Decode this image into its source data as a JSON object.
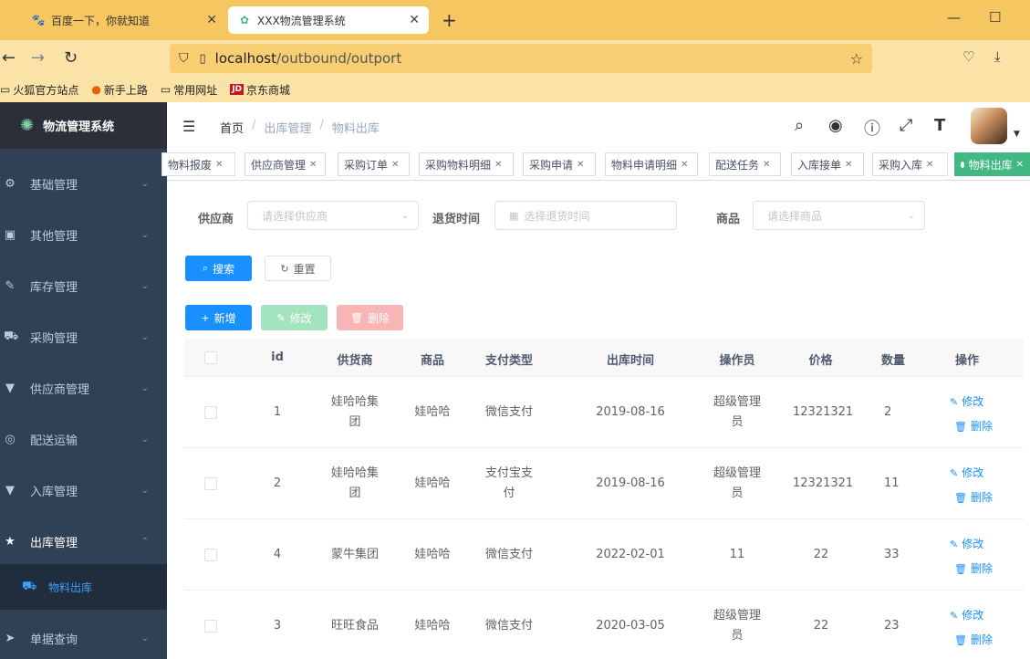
{
  "browser": {
    "tabs": [
      {
        "title": "百度一下，你就知道",
        "icon": "baidu-paw-icon"
      },
      {
        "title": "XXX物流管理系统",
        "icon": "app-leaf-icon"
      }
    ],
    "url_host": "localhost",
    "url_path": "/outbound/outport",
    "bookmarks": [
      "火狐官方站点",
      "新手上路",
      "常用网址",
      "京东商城"
    ],
    "bookmark_jd_badge": "JD"
  },
  "sidebar": {
    "app_name": "物流管理系统",
    "items": [
      {
        "label": "基础管理",
        "icon": "gear-icon"
      },
      {
        "label": "其他管理",
        "icon": "briefcase-icon"
      },
      {
        "label": "库存管理",
        "icon": "edit-icon"
      },
      {
        "label": "采购管理",
        "icon": "cart-icon"
      },
      {
        "label": "供应商管理",
        "icon": "shirt-icon"
      },
      {
        "label": "配送运输",
        "icon": "lifebuoy-icon"
      },
      {
        "label": "入库管理",
        "icon": "shirt-icon"
      },
      {
        "label": "出库管理",
        "icon": "star-icon"
      },
      {
        "label": "单据查询",
        "icon": "send-icon"
      }
    ],
    "sub_active": "物料出库"
  },
  "header": {
    "breadcrumb": [
      "首页",
      "出库管理",
      "物料出库"
    ]
  },
  "tags": [
    "物料报废",
    "供应商管理",
    "采购订单",
    "采购物料明细",
    "采购申请",
    "物料申请明细",
    "配送任务",
    "入库接单",
    "采购入库",
    "物料出库"
  ],
  "search": {
    "supplier_label": "供应商",
    "supplier_placeholder": "请选择供应商",
    "return_time_label": "退货时间",
    "return_time_placeholder": "选择退货时间",
    "goods_label": "商品",
    "goods_placeholder": "请选择商品",
    "search_btn": "搜索",
    "reset_btn": "重置"
  },
  "toolbar": {
    "add": "新增",
    "edit": "修改",
    "delete": "删除"
  },
  "table": {
    "columns": [
      "id",
      "供货商",
      "商品",
      "支付类型",
      "出库时间",
      "操作员",
      "价格",
      "数量",
      "操作"
    ],
    "rows": [
      {
        "id": "1",
        "supplier": [
          "娃哈哈集",
          "团"
        ],
        "goods": "娃哈哈",
        "pay": [
          "微信支付"
        ],
        "time": "2019-08-16",
        "operator": [
          "超级管理",
          "员"
        ],
        "price": "12321321",
        "qty": "2"
      },
      {
        "id": "2",
        "supplier": [
          "娃哈哈集",
          "团"
        ],
        "goods": "娃哈哈",
        "pay": [
          "支付宝支",
          "付"
        ],
        "time": "2019-08-16",
        "operator": [
          "超级管理",
          "员"
        ],
        "price": "12321321",
        "qty": "11"
      },
      {
        "id": "4",
        "supplier": [
          "蒙牛集团"
        ],
        "goods": "娃哈哈",
        "pay": [
          "微信支付"
        ],
        "time": "2022-02-01",
        "operator": [
          "11"
        ],
        "price": "22",
        "qty": "33"
      },
      {
        "id": "3",
        "supplier": [
          "旺旺食品"
        ],
        "goods": "娃哈哈",
        "pay": [
          "微信支付"
        ],
        "time": "2020-03-05",
        "operator": [
          "超级管理",
          "员"
        ],
        "price": "22",
        "qty": "23"
      }
    ],
    "row_edit": "修改",
    "row_delete": "删除"
  },
  "colors": {
    "sidebar_bg": "#304156",
    "primary": "#1890ff",
    "tag_active": "#42b983",
    "browser_tabbar": "#f6c760"
  }
}
